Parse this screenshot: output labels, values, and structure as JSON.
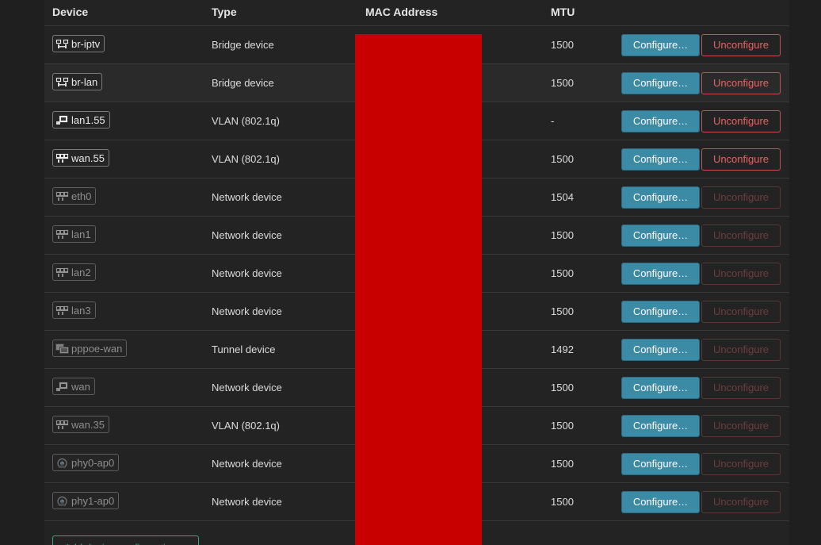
{
  "table": {
    "headers": {
      "device": "Device",
      "type": "Type",
      "mac": "MAC Address",
      "mtu": "MTU"
    },
    "rows": [
      {
        "device": "br-iptv",
        "icon": "bridge-icon",
        "dim": false,
        "type": "Bridge device",
        "mtu": "1500",
        "configure": "Configure…",
        "unconfigure": "Unconfigure",
        "unconfigure_enabled": true
      },
      {
        "device": "br-lan",
        "icon": "bridge-icon",
        "dim": false,
        "type": "Bridge device",
        "mtu": "1500",
        "configure": "Configure…",
        "unconfigure": "Unconfigure",
        "unconfigure_enabled": true
      },
      {
        "device": "lan1.55",
        "icon": "ethernet-port-icon",
        "dim": false,
        "type": "VLAN (802.1q)",
        "mtu": "-",
        "configure": "Configure…",
        "unconfigure": "Unconfigure",
        "unconfigure_enabled": true
      },
      {
        "device": "wan.55",
        "icon": "switch-icon",
        "dim": false,
        "type": "VLAN (802.1q)",
        "mtu": "1500",
        "configure": "Configure…",
        "unconfigure": "Unconfigure",
        "unconfigure_enabled": true
      },
      {
        "device": "eth0",
        "icon": "switch-icon",
        "dim": true,
        "type": "Network device",
        "mtu": "1504",
        "configure": "Configure…",
        "unconfigure": "Unconfigure",
        "unconfigure_enabled": false
      },
      {
        "device": "lan1",
        "icon": "switch-icon",
        "dim": true,
        "type": "Network device",
        "mtu": "1500",
        "configure": "Configure…",
        "unconfigure": "Unconfigure",
        "unconfigure_enabled": false
      },
      {
        "device": "lan2",
        "icon": "switch-icon",
        "dim": true,
        "type": "Network device",
        "mtu": "1500",
        "configure": "Configure…",
        "unconfigure": "Unconfigure",
        "unconfigure_enabled": false
      },
      {
        "device": "lan3",
        "icon": "switch-icon",
        "dim": true,
        "type": "Network device",
        "mtu": "1500",
        "configure": "Configure…",
        "unconfigure": "Unconfigure",
        "unconfigure_enabled": false
      },
      {
        "device": "pppoe-wan",
        "icon": "tunnel-icon",
        "dim": true,
        "type": "Tunnel device",
        "mtu": "1492",
        "configure": "Configure…",
        "unconfigure": "Unconfigure",
        "unconfigure_enabled": false
      },
      {
        "device": "wan",
        "icon": "ethernet-port-icon",
        "dim": true,
        "type": "Network device",
        "mtu": "1500",
        "configure": "Configure…",
        "unconfigure": "Unconfigure",
        "unconfigure_enabled": false
      },
      {
        "device": "wan.35",
        "icon": "switch-icon",
        "dim": true,
        "type": "VLAN (802.1q)",
        "mtu": "1500",
        "configure": "Configure…",
        "unconfigure": "Unconfigure",
        "unconfigure_enabled": false
      },
      {
        "device": "phy0-ap0",
        "icon": "wifi-antenna-icon",
        "dim": true,
        "type": "Network device",
        "mtu": "1500",
        "configure": "Configure…",
        "unconfigure": "Unconfigure",
        "unconfigure_enabled": false
      },
      {
        "device": "phy1-ap0",
        "icon": "wifi-antenna-icon",
        "dim": true,
        "type": "Network device",
        "mtu": "1500",
        "configure": "Configure…",
        "unconfigure": "Unconfigure",
        "unconfigure_enabled": false
      }
    ]
  },
  "add_button": "Add device configuration…",
  "colors": {
    "configure_button": "#3b8aa6",
    "unconfigure_active": "#e06664",
    "unconfigure_disabled": "#6e3e3e",
    "redaction": "#c80000",
    "add_button": "#3fa37a"
  }
}
